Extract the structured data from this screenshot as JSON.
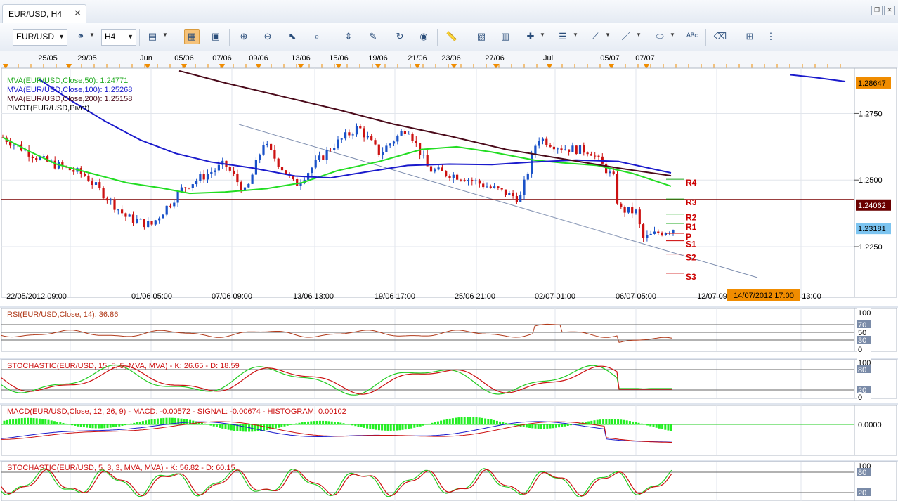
{
  "window": {
    "tab_title": "EUR/USD, H4"
  },
  "toolbar": {
    "symbol": "EUR/USD",
    "timeframe": "H4"
  },
  "colors": {
    "ma50": "#22dd22",
    "ma100": "#1a1acc",
    "ma200": "#4a0a1a",
    "candle_up": "#1a52c8",
    "candle_down": "#cc1111",
    "pivot_label": "#cc0000",
    "hline": "#7a0000",
    "rsi": "#b03a1a",
    "stoch_k": "#22cc22",
    "stoch_d": "#cc1111",
    "macd": "#1a1acc",
    "signal": "#cc1111",
    "histogram": "#22ee22"
  },
  "top_dates": [
    "25/05",
    "29/05",
    "Jun",
    "05/06",
    "07/06",
    "09/06",
    "13/06",
    "15/06",
    "19/06",
    "21/06",
    "23/06",
    "27/06",
    "Jul",
    "05/07",
    "07/07"
  ],
  "chart_data": [
    {
      "type": "line",
      "panel": "main",
      "legend": [
        {
          "text": "MVA(EUR/USD,Close,50): 1.24771",
          "color": "#22aa22"
        },
        {
          "text": "MVA(EUR/USD,Close,100): 1.25268",
          "color": "#1a1acc"
        },
        {
          "text": "MVA(EUR/USD,Close,200): 1.25158",
          "color": "#4a0a1a"
        },
        {
          "text": "PIVOT(EUR/USD,Pivot)",
          "color": "#000000"
        }
      ],
      "y_ticks": [
        "1.2750",
        "1.2500",
        "1.2250"
      ],
      "ylim": [
        1.206,
        1.292
      ],
      "x_ticks": [
        "22/05/2012 09:00",
        "01/06 05:00",
        "07/06 09:00",
        "13/06 13:00",
        "19/06 17:00",
        "25/06 21:00",
        "02/07 01:00",
        "06/07 05:00",
        "12/07 09:",
        "13:00"
      ],
      "cursor_date": "14/07/2012 17:00",
      "price_labels": [
        {
          "text": "1.28647",
          "value": 1.28647,
          "style": "orange"
        },
        {
          "text": "1.24062",
          "value": 1.24062,
          "style": "darkred"
        },
        {
          "text": "1.23181",
          "value": 1.23181,
          "style": "blue"
        }
      ],
      "pivots": [
        {
          "name": "R4",
          "value": 1.2503
        },
        {
          "name": "R3",
          "value": 1.2429
        },
        {
          "name": "R2",
          "value": 1.2372
        },
        {
          "name": "R1",
          "value": 1.2337
        },
        {
          "name": "P",
          "value": 1.23
        },
        {
          "name": "S1",
          "value": 1.2272
        },
        {
          "name": "S2",
          "value": 1.2222
        },
        {
          "name": "S3",
          "value": 1.215
        }
      ]
    },
    {
      "type": "line",
      "panel": "rsi",
      "legend": "RSI(EUR/USD,Close, 14): 36.86",
      "scale": [
        "100",
        "70",
        "50",
        "30",
        "0"
      ],
      "last": 36.86
    },
    {
      "type": "line",
      "panel": "stoch1",
      "legend": "STOCHASTIC(EUR/USD, 15, 5, 5, MVA, MVA) - K: 26.65 - D: 18.59",
      "scale": [
        "100",
        "80",
        "20",
        "0"
      ],
      "k": 26.65,
      "d": 18.59
    },
    {
      "type": "bar",
      "panel": "macd",
      "legend": "MACD(EUR/USD,Close, 12, 26, 9) - MACD: -0.00572 - SIGNAL: -0.00674 - HISTOGRAM: 0.00102",
      "scale": [
        "0.0000"
      ],
      "macd": -0.00572,
      "signal": -0.00674,
      "histogram": 0.00102
    },
    {
      "type": "line",
      "panel": "stoch2",
      "legend": "STOCHASTIC(EUR/USD, 5, 3, 3, MVA, MVA) - K: 56.82 - D: 60.15",
      "scale": [
        "100",
        "80",
        "20"
      ],
      "k": 56.82,
      "d": 60.15
    }
  ]
}
